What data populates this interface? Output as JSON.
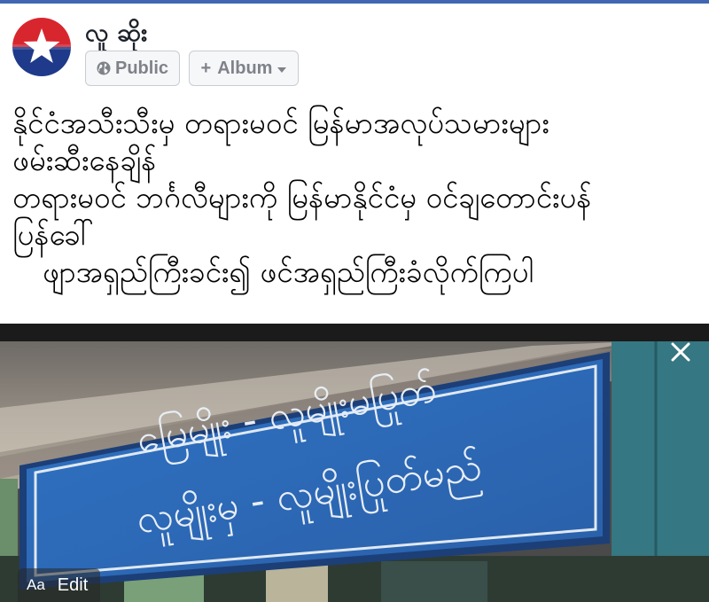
{
  "colors": {
    "accent": "#4267b2",
    "avatar_red": "#d8262e",
    "avatar_blue": "#1f3a8a",
    "sign_blue": "#2b6ab8",
    "pill_text": "#7f8289"
  },
  "author": {
    "name": "လူ ဆိုး",
    "avatar_icon": "star-flag-icon"
  },
  "audience": {
    "privacy_icon": "globe-icon",
    "privacy_label": "Public",
    "album_label": "Album",
    "album_icon": "plus-icon",
    "album_caret_icon": "chevron-down-icon"
  },
  "post": {
    "lines": [
      "နိုင်ငံအသီးသီးမှ တရားမဝင် မြန်မာအလုပ်သမားများ",
      "ဖမ်းဆီးနေချိန်",
      "တရားမဝင် ဘင်္ဂလီများကို မြန်မာနိုင်ငံမှ ဝင်ချတောင်းပန်",
      "ပြန်ခေါ်",
      "ဖျာအရှည်ကြီးခင်း၍  ဖင်အရှည်ကြီးခံလိုက်ကြပါ"
    ]
  },
  "photo": {
    "sign_lines": [
      "မြေမျိုး - လူမျိုးမပြုတ်",
      "လူမျိုးမှ - လူမျိုးပြုတ်မည်"
    ],
    "close_icon": "close-icon",
    "edit_prefix": "Aa",
    "edit_label": "Edit"
  }
}
